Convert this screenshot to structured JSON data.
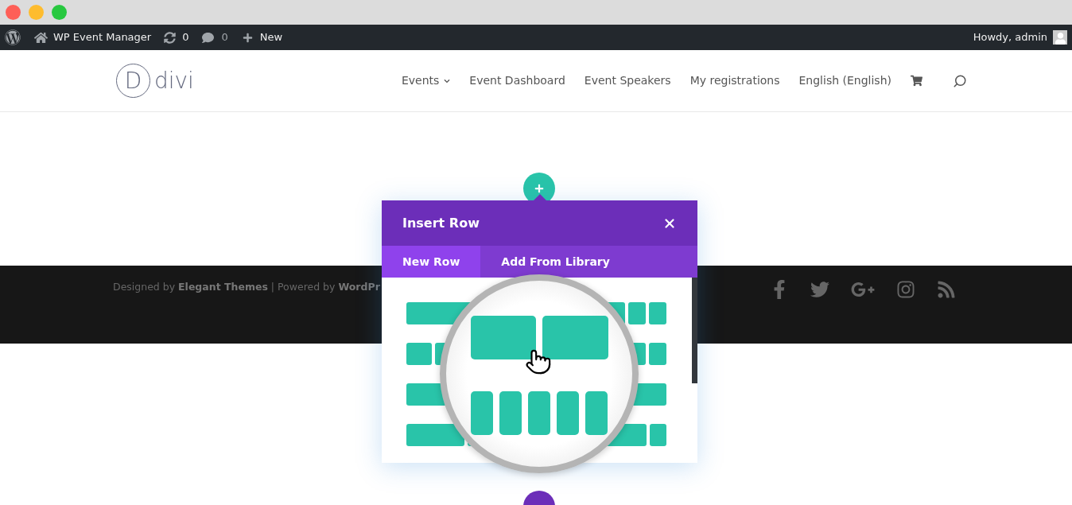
{
  "window": {
    "controls": [
      {
        "color": "#fe5f57"
      },
      {
        "color": "#febc2e"
      },
      {
        "color": "#28c840"
      }
    ]
  },
  "admin_bar": {
    "site": "WP Event Manager",
    "updates": "0",
    "comments": "0",
    "new": "New",
    "greeting": "Howdy, admin"
  },
  "header": {
    "logo_letter": "D",
    "logo_text": "divi",
    "nav": [
      {
        "label": "Events",
        "dropdown": true
      },
      {
        "label": "Event Dashboard",
        "dropdown": false
      },
      {
        "label": "Event Speakers",
        "dropdown": false
      },
      {
        "label": "My registrations",
        "dropdown": false
      },
      {
        "label": "English (English)",
        "dropdown": false
      }
    ]
  },
  "footer": {
    "credits": "Designed by **Elegant Themes** | Powered by **WordPr**"
  },
  "modal": {
    "title": "Insert Row",
    "tabs": [
      {
        "label": "New Row",
        "selected": true
      },
      {
        "label": "Add From Library",
        "selected": false
      }
    ]
  }
}
